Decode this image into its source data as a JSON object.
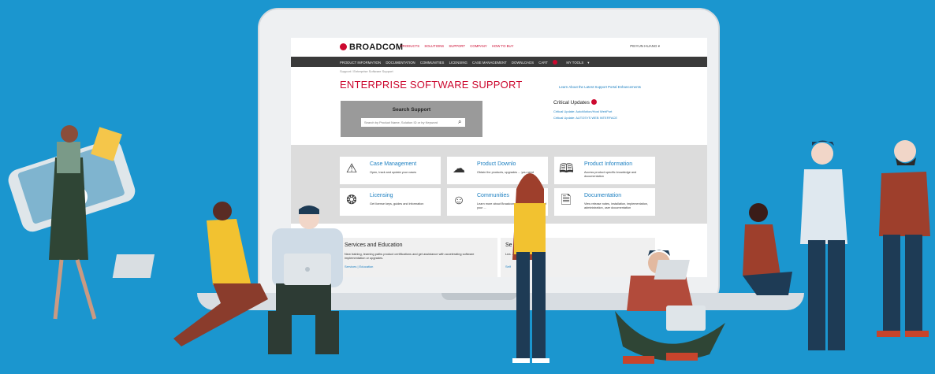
{
  "site": {
    "logo_text": "BROADCOM",
    "top_nav": [
      "PRODUCTS",
      "SOLUTIONS",
      "SUPPORT",
      "COMPANY",
      "HOW TO BUY"
    ],
    "user_name": "PEIYUN HUANG",
    "main_nav": [
      "PRODUCT INFORMATION",
      "DOCUMENTATION",
      "COMMUNITIES",
      "LICENSING",
      "CASE MANAGEMENT",
      "DOWNLOADS",
      "CART",
      "MY TOOLS"
    ],
    "breadcrumb": "Support / Enterprise Software Support",
    "page_title": "ENTERPRISE SOFTWARE SUPPORT",
    "learn_link": "Learn About the Latest Support Portal Enhancements",
    "search": {
      "label": "Search Support",
      "placeholder": "Search by Product Name, Solution ID or by Keyword"
    },
    "critical": {
      "heading": "Critical Updates",
      "links": [
        "Critical Update: AutoMotion/Host WebPort",
        "Critical Update: AUTOSYS WEB INTERFACE"
      ]
    },
    "cards": [
      {
        "title": "Case Management",
        "desc": "Open, track and update your cases"
      },
      {
        "title": "Product Downlo",
        "desc": "Obtain the products, upgrades ... you need"
      },
      {
        "title": "Product Information",
        "desc": "Access product specific knowledge and documentation"
      },
      {
        "title": "Licensing",
        "desc": "Get license keys, guides and information"
      },
      {
        "title": "Communities",
        "desc": "Learn more about Broadcom ... from a community of your ..."
      },
      {
        "title": "Documentation",
        "desc": "View release notes, installation, implementation, administration, user documentation"
      }
    ],
    "services": [
      {
        "title": "Services and Education",
        "desc": "New training, learning paths product certifications and get assistance with accelerating software implementation or upgrades.",
        "link": "Services | Education"
      },
      {
        "title": "Se",
        "desc": "Lea ... self service options.",
        "link": "Self"
      }
    ]
  },
  "colors": {
    "background": "#1b96cf",
    "brand_red": "#cc092f",
    "link_blue": "#1b7fc1"
  }
}
